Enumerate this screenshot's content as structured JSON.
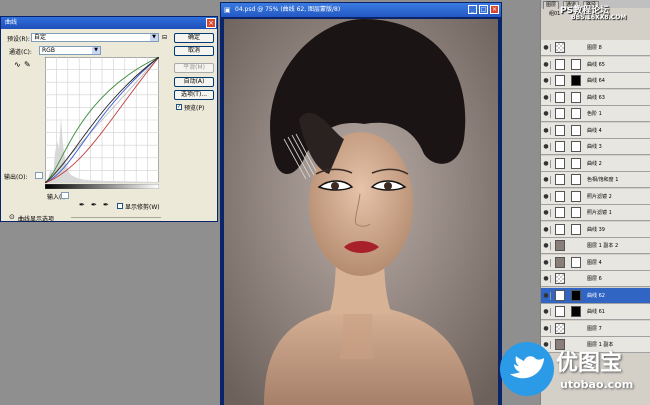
{
  "dialog": {
    "title": "曲线",
    "preset_label": "预设(R):",
    "preset_value": "自定",
    "channel_label": "通道(C):",
    "channel_value": "RGB",
    "output_label": "输出(O):",
    "input_label": "输入(I):",
    "show_clipping_label": "显示修剪(W)",
    "curve_options_label": "曲线显示选项",
    "buttons": {
      "ok": "确定",
      "cancel": "取消",
      "smooth": "平滑(M)",
      "auto": "自动(A)",
      "options": "选项(T)..."
    },
    "preview_label": "预览(P)",
    "preview_checked": true
  },
  "document": {
    "title": "04.psd @ 75% (曲线 62, 图层蒙版/8)"
  },
  "layers_panel": {
    "tabs": [
      "图层",
      "通道",
      "路径"
    ],
    "top_label": "组01",
    "layers": [
      {
        "name": "图层 8",
        "thumb": "check",
        "mask": false,
        "selected": false
      },
      {
        "name": "曲线 65",
        "thumb": "white",
        "mask": true,
        "selected": false
      },
      {
        "name": "曲线 64",
        "thumb": "white",
        "mask": true,
        "mask_black": true,
        "selected": false
      },
      {
        "name": "曲线 63",
        "thumb": "white",
        "mask": true,
        "selected": false
      },
      {
        "name": "色阶 1",
        "thumb": "white",
        "mask": true,
        "selected": false
      },
      {
        "name": "曲线 4",
        "thumb": "white",
        "mask": true,
        "selected": false
      },
      {
        "name": "曲线 3",
        "thumb": "white",
        "mask": true,
        "selected": false
      },
      {
        "name": "曲线 2",
        "thumb": "white",
        "mask": true,
        "selected": false
      },
      {
        "name": "色相/饱和度 1",
        "thumb": "white",
        "mask": true,
        "selected": false
      },
      {
        "name": "照片滤镜 2",
        "thumb": "white",
        "mask": true,
        "selected": false
      },
      {
        "name": "照片滤镜 1",
        "thumb": "white",
        "mask": true,
        "selected": false
      },
      {
        "name": "曲线 39",
        "thumb": "white",
        "mask": true,
        "selected": false
      },
      {
        "name": "图层 1 副本 2",
        "thumb": "gray",
        "mask": false,
        "selected": false
      },
      {
        "name": "图层 4",
        "thumb": "gray",
        "mask": true,
        "selected": false
      },
      {
        "name": "图层 6",
        "thumb": "check",
        "mask": false,
        "selected": false
      },
      {
        "name": "曲线 62",
        "thumb": "white",
        "mask": true,
        "mask_black": true,
        "selected": true
      },
      {
        "name": "曲线 61",
        "thumb": "white",
        "mask": true,
        "mask_black": true,
        "selected": false
      },
      {
        "name": "图层 7",
        "thumb": "check",
        "mask": false,
        "selected": false
      },
      {
        "name": "图层 1 副本",
        "thumb": "gray",
        "mask": false,
        "selected": false
      }
    ]
  },
  "watermarks": {
    "top": "PS教程论坛",
    "top_sub": "BBS.16XX8.COM",
    "brand": "优图宝",
    "brand_url": "utobao.com"
  },
  "colors": {
    "titlebar": "#2458c4",
    "selected_layer": "#3165c4",
    "bird": "#2b9be8"
  }
}
